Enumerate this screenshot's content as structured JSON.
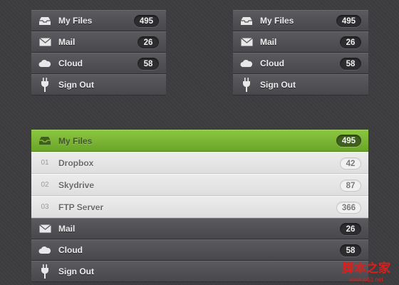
{
  "menu_left": {
    "items": [
      {
        "label": "My Files",
        "count": "495",
        "icon": "inbox-tray-icon"
      },
      {
        "label": "Mail",
        "count": "26",
        "icon": "envelope-icon"
      },
      {
        "label": "Cloud",
        "count": "58",
        "icon": "cloud-icon"
      },
      {
        "label": "Sign Out",
        "icon": "power-plug-icon"
      }
    ]
  },
  "menu_right": {
    "items": [
      {
        "label": "My Files",
        "count": "495",
        "icon": "inbox-tray-icon"
      },
      {
        "label": "Mail",
        "count": "26",
        "icon": "envelope-icon"
      },
      {
        "label": "Cloud",
        "count": "58",
        "icon": "cloud-icon"
      },
      {
        "label": "Sign Out",
        "icon": "power-plug-icon"
      }
    ]
  },
  "menu_big": {
    "active": {
      "label": "My Files",
      "count": "495",
      "icon": "inbox-tray-icon",
      "accent": "#7ab536"
    },
    "sub_items": [
      {
        "num": "01",
        "label": "Dropbox",
        "count": "42"
      },
      {
        "num": "02",
        "label": "Skydrive",
        "count": "87"
      },
      {
        "num": "03",
        "label": "FTP Server",
        "count": "366"
      }
    ],
    "items": [
      {
        "label": "Mail",
        "count": "26",
        "icon": "envelope-icon"
      },
      {
        "label": "Cloud",
        "count": "58",
        "icon": "cloud-icon"
      },
      {
        "label": "Sign Out",
        "icon": "power-plug-icon"
      }
    ]
  },
  "watermark": {
    "text": "脚本之家",
    "url": "www.jb51.net"
  }
}
